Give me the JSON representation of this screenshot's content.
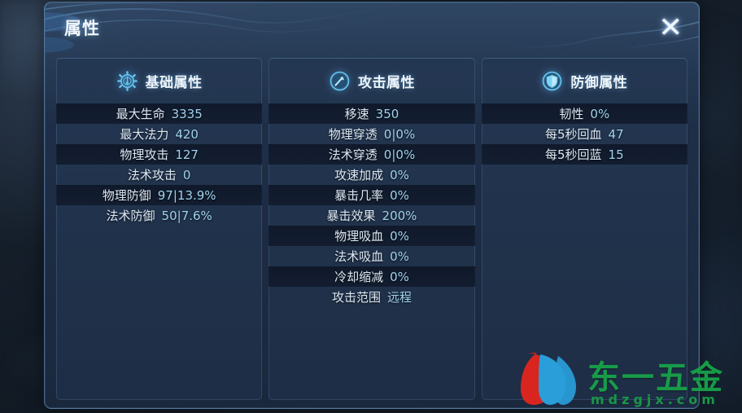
{
  "dialog": {
    "title": "属性",
    "close_label": "✕",
    "close_icon": "close-icon"
  },
  "columns": [
    {
      "icon": "gear-compass-icon",
      "title": "基础属性",
      "rows": [
        {
          "label": "最大生命",
          "value": "3335"
        },
        {
          "label": "最大法力",
          "value": "420"
        },
        {
          "label": "物理攻击",
          "value": "127"
        },
        {
          "label": "法术攻击",
          "value": "0"
        },
        {
          "label": "物理防御",
          "value": "97|13.9%"
        },
        {
          "label": "法术防御",
          "value": "50|7.6%"
        }
      ]
    },
    {
      "icon": "sword-circle-icon",
      "title": "攻击属性",
      "rows": [
        {
          "label": "移速",
          "value": "350"
        },
        {
          "label": "物理穿透",
          "value": "0|0%"
        },
        {
          "label": "法术穿透",
          "value": "0|0%"
        },
        {
          "label": "攻速加成",
          "value": "0%"
        },
        {
          "label": "暴击几率",
          "value": "0%"
        },
        {
          "label": "暴击效果",
          "value": "200%"
        },
        {
          "label": "物理吸血",
          "value": "0%"
        },
        {
          "label": "法术吸血",
          "value": "0%"
        },
        {
          "label": "冷却缩减",
          "value": "0%"
        },
        {
          "label": "攻击范围",
          "value": "远程"
        }
      ]
    },
    {
      "icon": "shield-circle-icon",
      "title": "防御属性",
      "rows": [
        {
          "label": "韧性",
          "value": "0%"
        },
        {
          "label": "每5秒回血",
          "value": "47"
        },
        {
          "label": "每5秒回蓝",
          "value": "15"
        }
      ]
    }
  ],
  "watermark": {
    "brand": "东一五金",
    "url": "mdzgjx.com"
  },
  "colors": {
    "panel_blue": "#253a58",
    "accent_cyan": "#9fd2ee",
    "label_white": "#dce8f4",
    "row_dark": "#0a1221",
    "brand_green": "#18a04a",
    "logo_red": "#e0251f",
    "logo_blue": "#2aa3e0"
  }
}
